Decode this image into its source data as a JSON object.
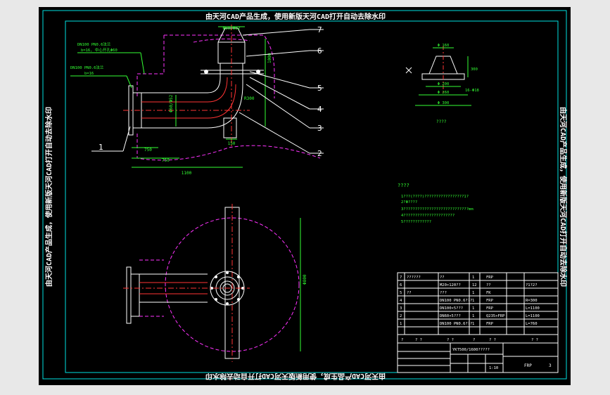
{
  "watermark": {
    "text": "由天河CAD产品生成，使用新版天河CAD打开自动去除水印"
  },
  "balloons": [
    "1",
    "2",
    "3",
    "4",
    "5",
    "6",
    "7"
  ],
  "dimensions": {
    "main_top": "Φ60/Φ52",
    "main_right": "1000",
    "main_height": "Φ60/Φ52",
    "main_bottom": "1100",
    "main_left1": "750",
    "main_left2": "750",
    "mid": "R300",
    "bot": "150",
    "label_top1": "DN100 PN0.6法兰",
    "label_top2": "b=16, 中心开孔Φ60",
    "label_mid1": "DN100 PN0.6法兰",
    "label_mid2": "b=16",
    "plan_v": "Φ800",
    "detail_top": "Φ 160",
    "detail_mid": "Φ 200",
    "detail_h": "300",
    "detail_bot": "Φ 260",
    "detail_bot2": "Φ 300",
    "detail_side": "16-Φ18",
    "detail_caption": "????"
  },
  "notes": {
    "title": "????",
    "lines": [
      "1???(????)?????????????????1?",
      "2?Φ????",
      "3????????????????????????????mm",
      "4??????????????????????",
      "5????????????"
    ]
  },
  "bom": {
    "rows": [
      {
        "no": "7",
        "name": "??????",
        "spec": "??",
        "qty": "1",
        "mat": "FRP",
        "note": ""
      },
      {
        "no": "6",
        "name": "",
        "spec": "M20×120??",
        "qty": "12",
        "mat": "??",
        "note": "?1?2?"
      },
      {
        "no": "5",
        "name": "??",
        "spec": "???",
        "qty": "1",
        "mat": "FK",
        "note": ""
      },
      {
        "no": "4",
        "name": "",
        "spec": "DN100 PN0.6???",
        "qty": "1",
        "mat": "FRP",
        "note": "R=300"
      },
      {
        "no": "3",
        "name": "",
        "spec": "DN100×5???",
        "qty": "1",
        "mat": "FRP",
        "note": "L=1100"
      },
      {
        "no": "2",
        "name": "",
        "spec": "DN60×5???",
        "qty": "1",
        "mat": "Q235+FRP",
        "note": "L=1100"
      },
      {
        "no": "1",
        "name": "",
        "spec": "DN100 PN0.6???",
        "qty": "1",
        "mat": "FRP",
        "note": "L=760"
      }
    ],
    "header": {
      "no": "?",
      "name": "? ?",
      "spec": "? ?",
      "qty": "?",
      "mat": "? ?",
      "note": "? ?"
    },
    "drawing_no": "YKT500/1600?????",
    "material": "FRP",
    "sheet": "3",
    "scale": "1:10"
  }
}
